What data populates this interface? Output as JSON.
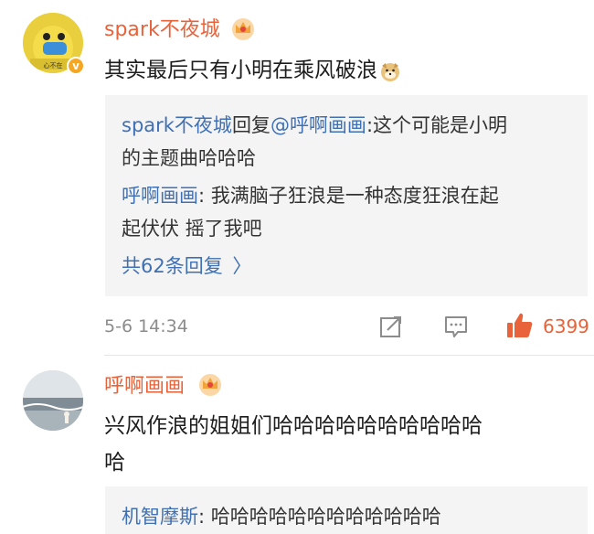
{
  "comment1": {
    "username": "spark不夜城",
    "avatar_caption": "心不在",
    "text": "其实最后只有小明在乘风破浪",
    "emoji": "doge-emoji",
    "replies": {
      "r1_user": "spark不夜城",
      "r1_word": "回复",
      "r1_mention": "@呼啊画画",
      "r1_text_a": ":这个可能是小明",
      "r1_text_b": "的主题曲哈哈哈",
      "r2_user": "呼啊画画",
      "r2_text_a": ": 我满脑子狂浪是一种态度狂浪在起",
      "r2_text_b": "起伏伏 摇了我吧",
      "more": "共62条回复",
      "more_arrow": "〉"
    },
    "time": "5-6 14:34",
    "likes": "6399",
    "colors": {
      "name": "#e8623a",
      "link": "#3f70b3",
      "verified": "#f5a623"
    }
  },
  "comment2": {
    "username": "呼啊画画",
    "text_a": "兴风作浪的姐姐们哈哈哈哈哈哈哈哈哈哈",
    "text_b": "哈",
    "reply": {
      "user": "机智摩斯",
      "text": ": 哈哈哈哈哈哈哈哈哈哈哈哈"
    }
  },
  "icons": [
    "vip-crown-icon",
    "share-icon",
    "comment-icon",
    "like-icon"
  ]
}
